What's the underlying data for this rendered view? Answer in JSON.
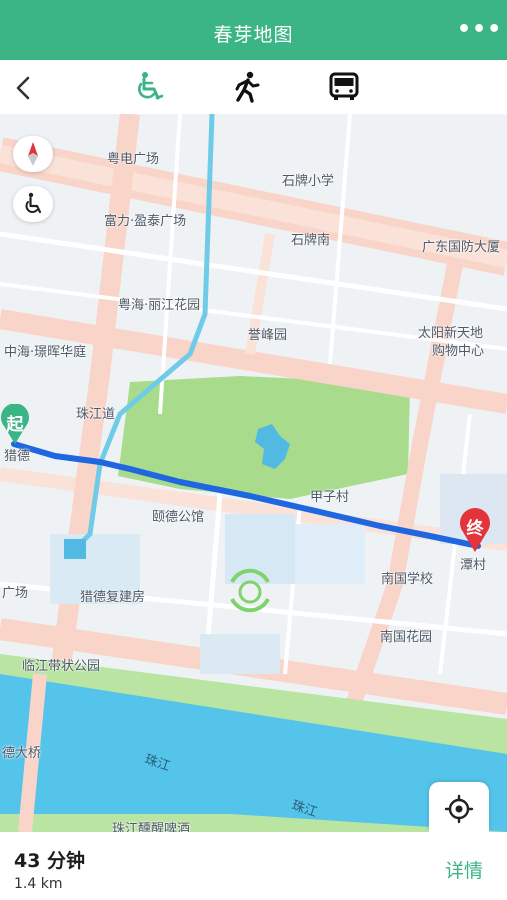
{
  "header": {
    "title": "春芽地图",
    "more_label": "•••"
  },
  "modes": [
    {
      "name": "wheelchair",
      "active": true
    },
    {
      "name": "walking",
      "active": false
    },
    {
      "name": "bus",
      "active": false
    }
  ],
  "colors": {
    "accent": "#3bb586",
    "route": "#1e67e0",
    "start_pin": "#3bb586",
    "end_pin": "#e2343a"
  },
  "map": {
    "labels": {
      "l1": "粤电广场",
      "l2": "石牌小学",
      "l3": "富力·盈泰广场",
      "l4": "石牌南",
      "l5": "广东国防大厦",
      "l6": "粤海·丽江花园",
      "l7": "誉峰园",
      "l8": "太阳新天地",
      "l9": "购物中心",
      "l10": "中海·璟晖华庭",
      "l11": "珠江道",
      "l12": "猎德",
      "l13": "甲子村",
      "l14": "颐德公馆",
      "l15": "潭村",
      "l16": "南国学校",
      "l17": "广场",
      "l18": "猎德复建房",
      "l19": "南国花园",
      "l20": "临江带状公园",
      "l21": "德大桥",
      "l22": "珠江",
      "l23": "珠江",
      "l24": "珠江醺醒啤酒"
    },
    "start_label": "起",
    "end_label": "终"
  },
  "route": {
    "duration": "43 分钟",
    "distance": "1.4 km",
    "detail_label": "详情"
  }
}
